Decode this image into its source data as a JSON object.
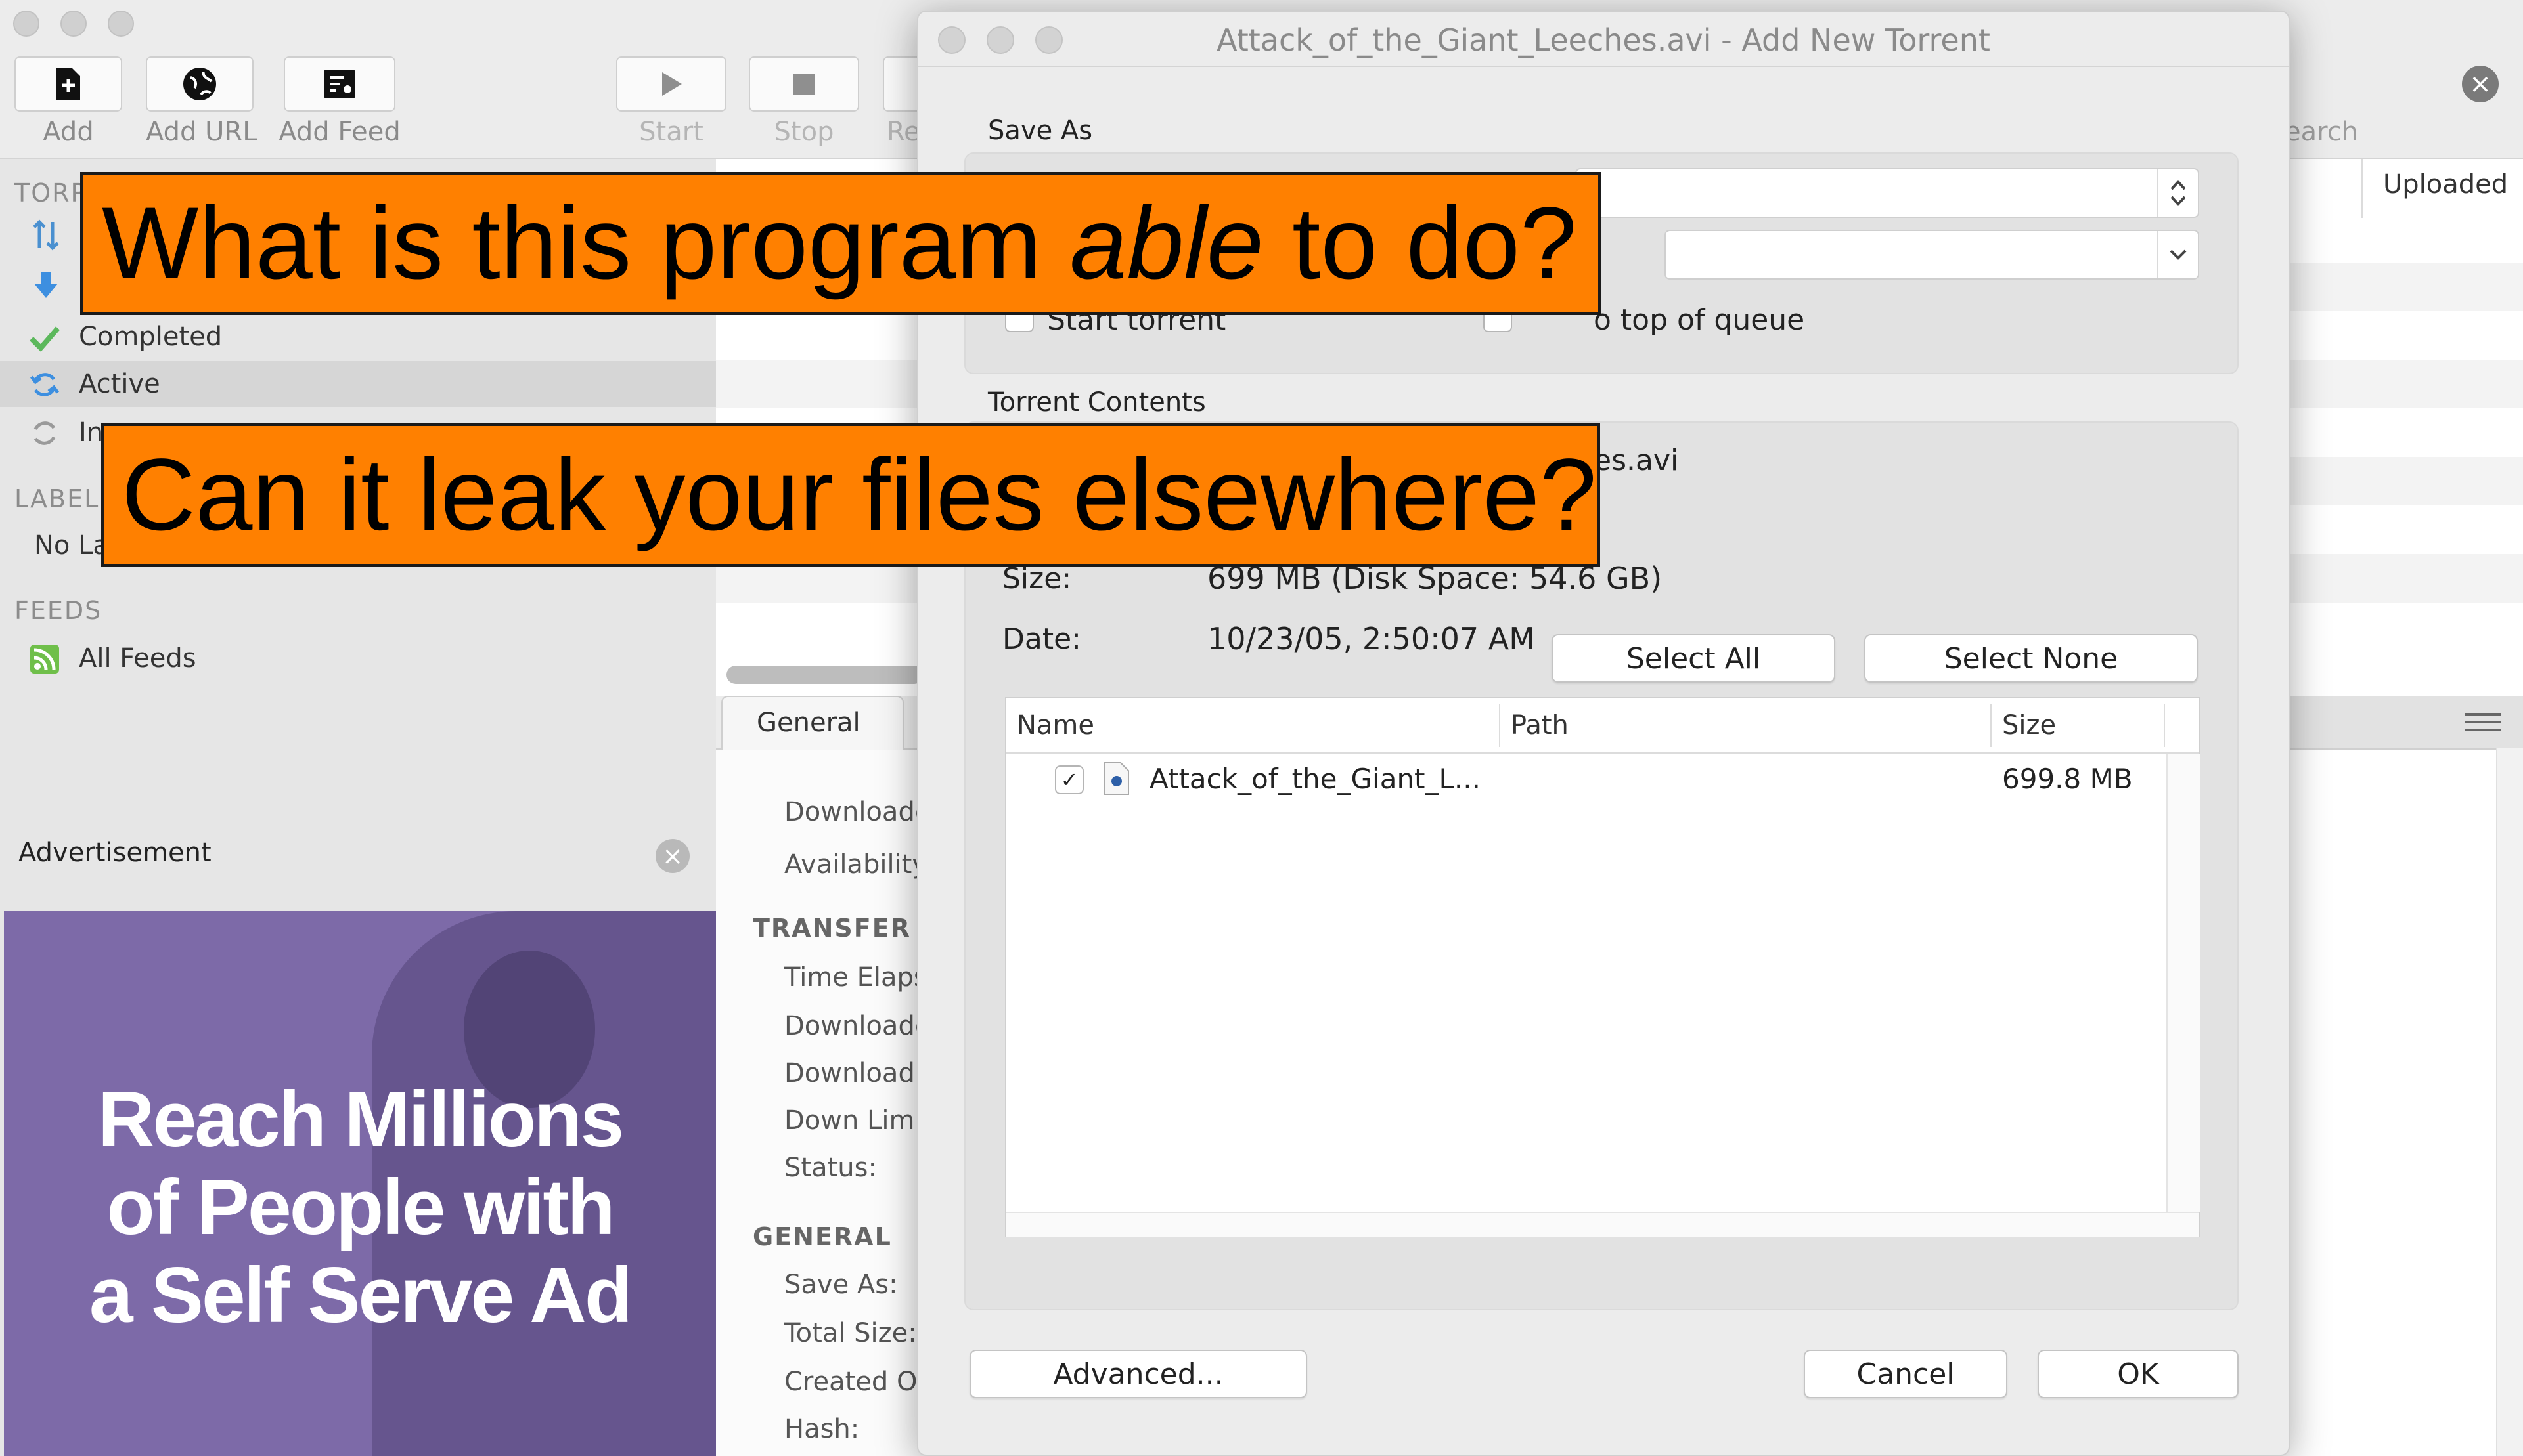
{
  "toolbar": {
    "add": "Add",
    "add_url": "Add URL",
    "add_feed": "Add Feed",
    "start": "Start",
    "stop": "Stop",
    "remove_partial": "Re",
    "search_partial": "earch"
  },
  "sidebar": {
    "torrents_head_partial": "TORR",
    "completed": "Completed",
    "active": "Active",
    "inactive_partial": "In",
    "labels_head_partial": "LABEL",
    "no_labels_partial": "No La",
    "feeds_head": "FEEDS",
    "all_feeds": "All Feeds"
  },
  "advertisement": {
    "title": "Advertisement",
    "close_glyph": "×",
    "line1": "Reach Millions",
    "line2": "of People with",
    "line3": "a Self Serve Ad"
  },
  "list": {
    "uploaded_col": "Uploaded"
  },
  "details": {
    "tab_general": "General",
    "downloaded_partial": "Downloade",
    "availability_partial": "Availability",
    "transfer_head": "TRANSFER",
    "time_elapsed_partial": "Time Elaps",
    "downloaded2_partial": "Downloade",
    "download_partial": "Download",
    "down_limit_partial": "Down Limi",
    "status": "Status:",
    "general_head": "GENERAL",
    "save_as": "Save As:",
    "total_size": "Total Size:",
    "created_on_partial": "Created O",
    "hash": "Hash:"
  },
  "dialog": {
    "title": "Attack_of_the_Giant_Leeches.avi - Add New Torrent",
    "save_as_head": "Save As",
    "start_torrent_partial": "Start torrent",
    "add_top_queue": "Add to top of queue",
    "add_top_queue_visible": "o top of queue",
    "torrent_contents_head": "Torrent Contents",
    "filename_partial": "es.avi",
    "size_label": "Size:",
    "size_value": "699 MB (Disk Space: 54.6 GB)",
    "date_label": "Date:",
    "date_value": "10/23/05, 2:50:07 AM",
    "select_all": "Select All",
    "select_none": "Select None",
    "col_name": "Name",
    "col_path": "Path",
    "col_size": "Size",
    "file_name": "Attack_of_the_Giant_L...",
    "file_size": "699.8 MB",
    "check_glyph": "✓",
    "advanced": "Advanced...",
    "cancel": "Cancel",
    "ok": "OK"
  },
  "overlay": {
    "question1_before": "What is this program ",
    "question1_em": "able",
    "question1_after": " to do?",
    "question2": "Can it leak your files elsewhere?"
  },
  "colors": {
    "banner": "#ff8000",
    "ad_background": "#7d6aa8",
    "active_row": "#d6d6d6"
  }
}
